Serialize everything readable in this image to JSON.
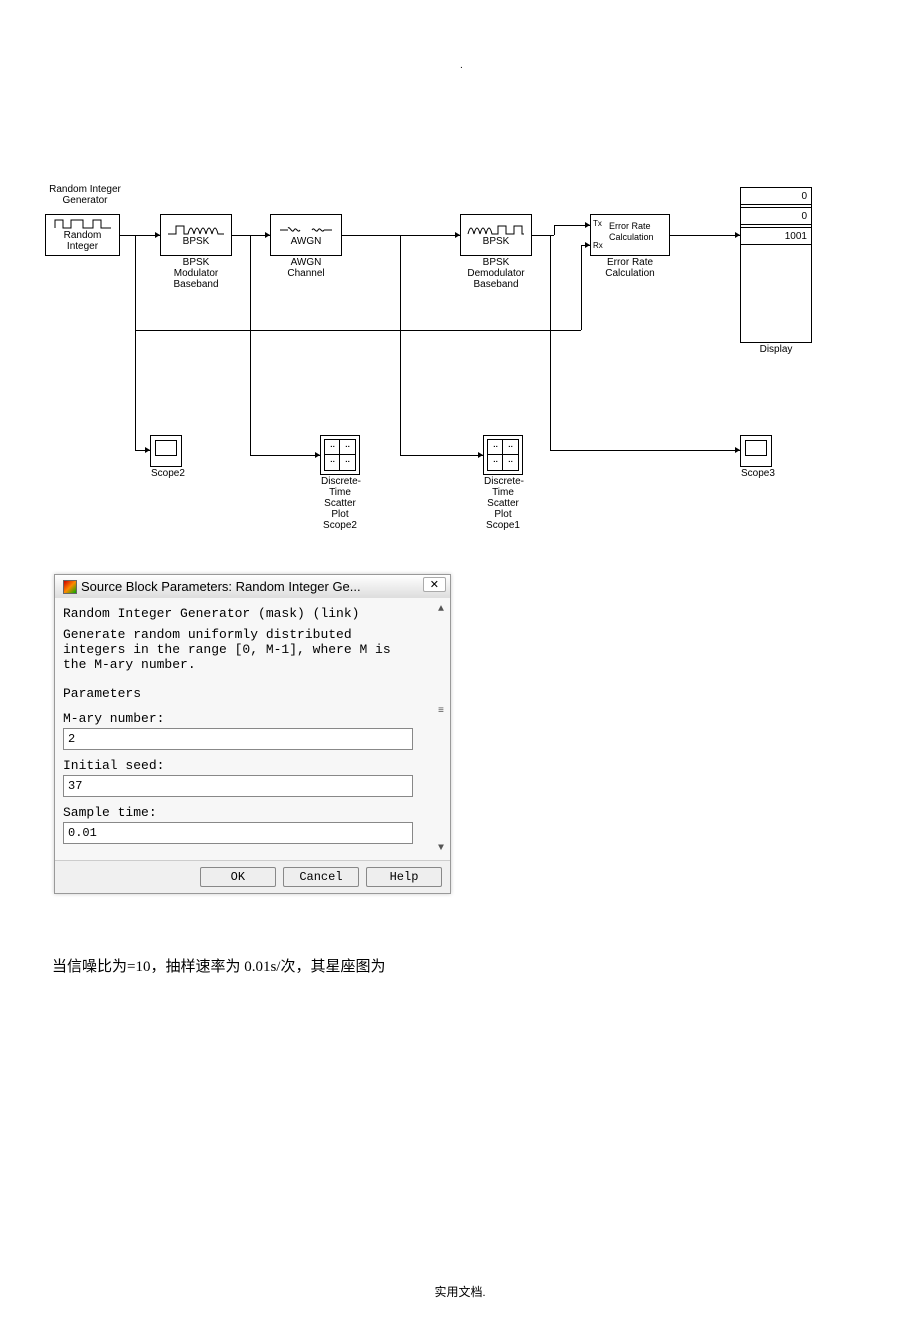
{
  "dot_top": ".",
  "diagram": {
    "random_integer_title": "Random Integer\nGenerator",
    "random_integer_inner": "Random\nInteger",
    "bpsk_mod_inner": "BPSK",
    "bpsk_mod_label": "BPSK\nModulator\nBaseband",
    "awgn_inner": "AWGN",
    "awgn_label": "AWGN\nChannel",
    "bpsk_demod_inner": "BPSK",
    "bpsk_demod_label": "BPSK\nDemodulator\nBaseband",
    "error_rate_tx": "Tx",
    "error_rate_rx": "Rx",
    "error_rate_inner": "Error Rate\nCalculation",
    "error_rate_label": "Error Rate\nCalculation",
    "display_vals": [
      "0",
      "0",
      "1001"
    ],
    "display_label": "Display",
    "scope2_label": "Scope2",
    "scope3_label": "Scope3",
    "scatter2_label": "Discrete-Time\nScatter Plot\nScope2",
    "scatter1_label": "Discrete-Time\nScatter Plot\nScope1"
  },
  "dialog": {
    "title": "Source Block Parameters: Random Integer Ge...",
    "close": "✕",
    "header": "Random Integer Generator (mask) (link)",
    "desc": "Generate random uniformly distributed\nintegers in the range [0, M-1], where M is\nthe M-ary number.",
    "section": "Parameters",
    "mary_label": "M-ary number:",
    "mary_val": "2",
    "seed_label": "Initial seed:",
    "seed_val": "37",
    "sample_label": "Sample time:",
    "sample_val": "0.01",
    "ok": "OK",
    "cancel": "Cancel",
    "help": "Help"
  },
  "caption": "当信噪比为=10，抽样速率为 0.01s/次，其星座图为",
  "footer": "实用文档."
}
